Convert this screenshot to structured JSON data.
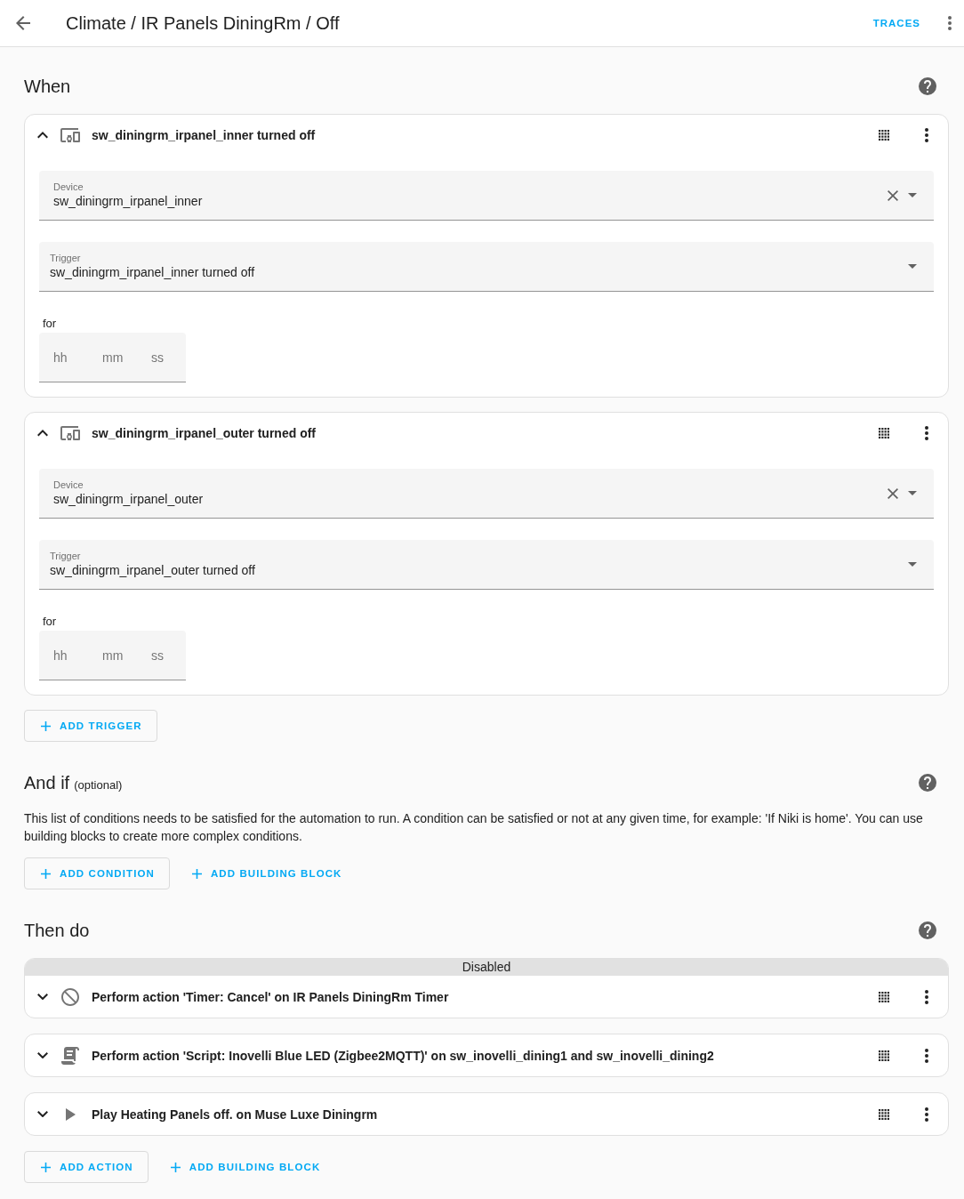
{
  "header": {
    "title": "Climate / IR Panels DiningRm / Off",
    "traces_button": "TRACES"
  },
  "triggers_section": {
    "title": "When",
    "items": [
      {
        "kind": "device",
        "expanded": true,
        "title": "sw_diningrm_irpanel_inner turned off",
        "fields": [
          {
            "kind": "device",
            "label": "Device",
            "value": "sw_diningrm_irpanel_inner"
          },
          {
            "kind": "select",
            "label": "Trigger",
            "value": "sw_diningrm_irpanel_inner turned off"
          },
          {
            "kind": "duration",
            "label": "for",
            "placeholders": [
              "hh",
              "mm",
              "ss"
            ]
          }
        ]
      },
      {
        "kind": "device",
        "expanded": true,
        "title": "sw_diningrm_irpanel_outer turned off",
        "fields": [
          {
            "kind": "device",
            "label": "Device",
            "value": "sw_diningrm_irpanel_outer"
          },
          {
            "kind": "select",
            "label": "Trigger",
            "value": "sw_diningrm_irpanel_outer turned off"
          },
          {
            "kind": "duration",
            "label": "for",
            "placeholders": [
              "hh",
              "mm",
              "ss"
            ]
          }
        ]
      }
    ],
    "buttons": [
      {
        "kind": "outlined",
        "label": "ADD TRIGGER"
      }
    ]
  },
  "conditions_section": {
    "title": "And if",
    "subtitle": "(optional)",
    "description": "This list of conditions needs to be satisfied for the automation to run. A condition can be satisfied or not at any given time, for example: 'If Niki is home'. You can use building blocks to create more complex conditions.",
    "buttons": [
      {
        "kind": "outlined",
        "label": "ADD CONDITION"
      },
      {
        "kind": "text",
        "label": "ADD BUILDING BLOCK"
      }
    ]
  },
  "actions_section": {
    "title": "Then do",
    "items": [
      {
        "kind": "cancel",
        "expanded": false,
        "disabled": true,
        "banner": "Disabled",
        "title": "Perform action 'Timer: Cancel' on IR Panels DiningRm Timer"
      },
      {
        "kind": "script",
        "expanded": false,
        "disabled": false,
        "title": "Perform action 'Script: Inovelli Blue LED (Zigbee2MQTT)' on sw_inovelli_dining1 and sw_inovelli_dining2"
      },
      {
        "kind": "play",
        "expanded": false,
        "disabled": false,
        "title": "Play Heating Panels off. on Muse Luxe Diningrm"
      }
    ],
    "buttons": [
      {
        "kind": "outlined",
        "label": "ADD ACTION"
      },
      {
        "kind": "text",
        "label": "ADD BUILDING BLOCK"
      }
    ]
  }
}
